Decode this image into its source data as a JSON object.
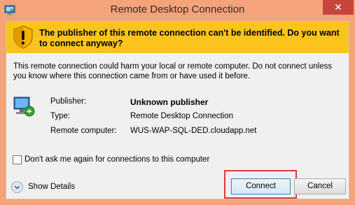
{
  "window": {
    "title": "Remote Desktop Connection",
    "close_glyph": "✕"
  },
  "banner": {
    "icon": "warning-shield-icon",
    "text": "The publisher of this remote connection can't be identified. Do you want to connect anyway?",
    "color": "#fbc41d"
  },
  "body": {
    "warning": "This remote connection could harm your local or remote computer. Do not connect unless you know where this connection came from or have used it before.",
    "icon": "computer-icon",
    "rows": [
      {
        "label": "Publisher:",
        "value": "Unknown publisher"
      },
      {
        "label": "Type:",
        "value": "Remote Desktop Connection"
      },
      {
        "label": "Remote computer:",
        "value": "WUS-WAP-SQL-DED.cloudapp.net"
      }
    ]
  },
  "checkbox": {
    "label": "Don't ask me again for connections to this computer",
    "checked": false
  },
  "footer": {
    "details_label": "Show Details",
    "connect_label": "Connect",
    "cancel_label": "Cancel",
    "highlight_color": "#e13a3a"
  }
}
